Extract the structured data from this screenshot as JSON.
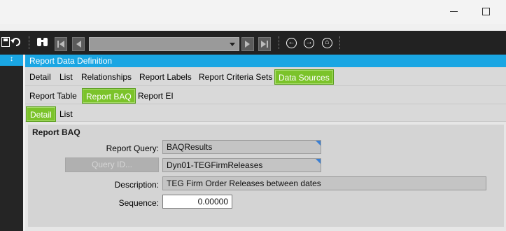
{
  "window": {
    "minimize_icon": "minimize-icon",
    "maximize_icon": "maximize-icon"
  },
  "toolbar": {
    "icons": [
      "save-icon",
      "undo-icon",
      "binoculars-icon",
      "first-record-icon",
      "previous-record-icon",
      "next-record-icon",
      "last-record-icon",
      "back-icon",
      "forward-icon",
      "home-icon"
    ],
    "navigator_value": "",
    "pin_label": "↕"
  },
  "panel": {
    "title": "Report Data Definition"
  },
  "main_tabs": [
    "Detail",
    "List",
    "Relationships",
    "Report Labels",
    "Report Criteria Sets",
    "Data Sources"
  ],
  "sub_tabs": [
    "Report Table",
    "Report BAQ",
    "Report EI"
  ],
  "view_tabs": [
    "Detail",
    "List"
  ],
  "form": {
    "group_title": "Report BAQ",
    "report_query": {
      "label": "Report Query:",
      "value": "BAQResults"
    },
    "query_id": {
      "button_label": "Query ID...",
      "value": "Dyn01-TEGFirmReleases"
    },
    "description": {
      "label": "Description:",
      "value": "TEG Firm Order Releases between dates"
    },
    "sequence": {
      "label": "Sequence:",
      "value": "0.00000"
    }
  },
  "colors": {
    "accent_blue": "#1aa6e3",
    "active_tab_green": "#7bc32a",
    "toolbar_bg": "#222222"
  }
}
